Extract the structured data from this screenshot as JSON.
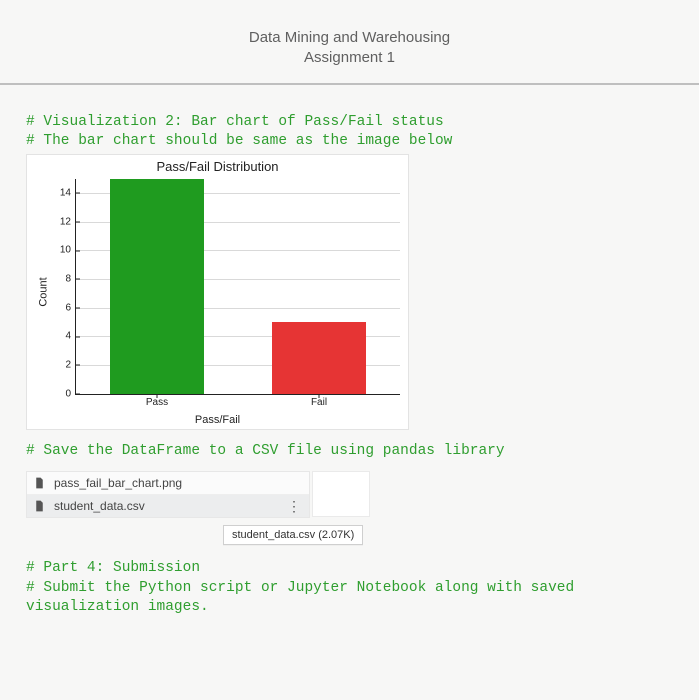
{
  "header": {
    "course": "Data Mining and Warehousing",
    "assignment": "Assignment 1"
  },
  "code": {
    "viz_comment_1": "# Visualization 2: Bar chart of Pass/Fail status",
    "viz_comment_2": "# The bar chart should be same as the image below",
    "save_df_comment": "# Save the DataFrame to a CSV file using pandas library",
    "part4_1": "# Part 4: Submission",
    "part4_2": "# Submit the Python script or Jupyter Notebook along with saved visualization images."
  },
  "files": {
    "item1": "pass_fail_bar_chart.png",
    "item2": "student_data.csv",
    "tooltip": "student_data.csv (2.07K)"
  },
  "chart_data": {
    "type": "bar",
    "title": "Pass/Fail Distribution",
    "xlabel": "Pass/Fail",
    "ylabel": "Count",
    "categories": [
      "Pass",
      "Fail"
    ],
    "values": [
      15,
      5
    ],
    "colors": [
      "#1f9b1f",
      "#e63434"
    ],
    "yticks": [
      0,
      2,
      4,
      6,
      8,
      10,
      12,
      14
    ],
    "ylim": [
      0,
      15
    ]
  }
}
